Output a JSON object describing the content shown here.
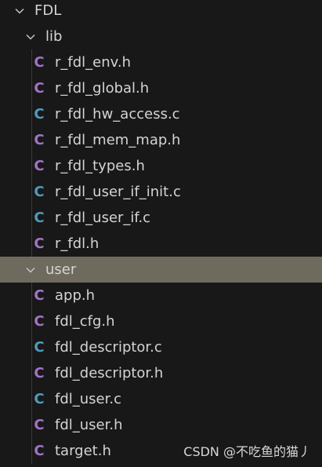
{
  "explorer": {
    "root": {
      "label": "FDL"
    },
    "lib": {
      "label": "lib",
      "files": [
        {
          "name": "r_fdl_env.h",
          "icon_letter": "C",
          "icon": "c-header-icon",
          "color": "#a074c4"
        },
        {
          "name": "r_fdl_global.h",
          "icon_letter": "C",
          "icon": "c-header-icon",
          "color": "#a074c4"
        },
        {
          "name": "r_fdl_hw_access.c",
          "icon_letter": "C",
          "icon": "c-source-icon",
          "color": "#519aba"
        },
        {
          "name": "r_fdl_mem_map.h",
          "icon_letter": "C",
          "icon": "c-header-icon",
          "color": "#a074c4"
        },
        {
          "name": "r_fdl_types.h",
          "icon_letter": "C",
          "icon": "c-header-icon",
          "color": "#a074c4"
        },
        {
          "name": "r_fdl_user_if_init.c",
          "icon_letter": "C",
          "icon": "c-source-icon",
          "color": "#519aba"
        },
        {
          "name": "r_fdl_user_if.c",
          "icon_letter": "C",
          "icon": "c-source-icon",
          "color": "#519aba"
        },
        {
          "name": "r_fdl.h",
          "icon_letter": "C",
          "icon": "c-header-icon",
          "color": "#a074c4"
        }
      ]
    },
    "user": {
      "label": "user",
      "files": [
        {
          "name": "app.h",
          "icon_letter": "C",
          "icon": "c-header-icon",
          "color": "#a074c4"
        },
        {
          "name": "fdl_cfg.h",
          "icon_letter": "C",
          "icon": "c-header-icon",
          "color": "#a074c4"
        },
        {
          "name": "fdl_descriptor.c",
          "icon_letter": "C",
          "icon": "c-source-icon",
          "color": "#519aba"
        },
        {
          "name": "fdl_descriptor.h",
          "icon_letter": "C",
          "icon": "c-header-icon",
          "color": "#a074c4"
        },
        {
          "name": "fdl_user.c",
          "icon_letter": "C",
          "icon": "c-source-icon",
          "color": "#519aba"
        },
        {
          "name": "fdl_user.h",
          "icon_letter": "C",
          "icon": "c-header-icon",
          "color": "#a074c4"
        },
        {
          "name": "target.h",
          "icon_letter": "C",
          "icon": "c-header-icon",
          "color": "#a074c4"
        }
      ]
    }
  },
  "watermark": "CSDN @不吃鱼的猫丿",
  "colors": {
    "background": "#181818",
    "selected_row": "#6e6b5e",
    "text": "#d4d4d4",
    "header_icon": "#a074c4",
    "source_icon": "#519aba"
  }
}
